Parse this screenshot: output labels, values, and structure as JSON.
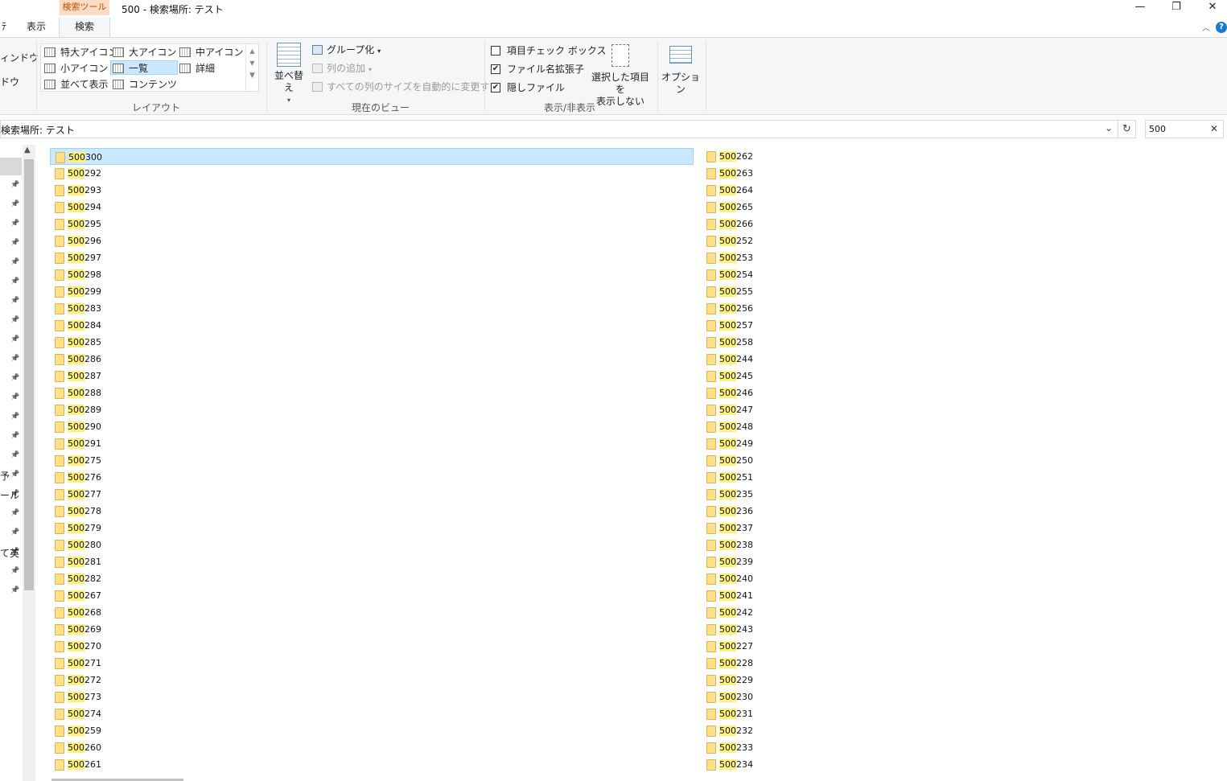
{
  "window": {
    "title": "500 - 検索場所: テスト",
    "tool_tab": "検索ツール",
    "minimize": "—",
    "restore": "❐",
    "close": "✕"
  },
  "tabs": [
    {
      "label": "ﾃ"
    },
    {
      "label": "表示"
    },
    {
      "label": "検索"
    }
  ],
  "ribbon": {
    "pane_frag1": "ィンドウ",
    "pane_frag2": "ドウ",
    "layout": {
      "items": [
        "特大アイコン",
        "大アイコン",
        "中アイコン",
        "小アイコン",
        "一覧",
        "詳細",
        "並べて表示",
        "コンテンツ"
      ],
      "selected": "一覧",
      "label": "レイアウト"
    },
    "view": {
      "sort": "並べ替え",
      "group": "グループ化",
      "add_column": "列の追加",
      "autosize": "すべての列のサイズを自動的に変更する",
      "label": "現在のビュー"
    },
    "showhide": {
      "item_checkbox": "項目チェック ボックス",
      "extensions": "ファイル名拡張子",
      "hidden": "隠しファイル",
      "hide_selected_1": "選択した項目を",
      "hide_selected_2": "表示しない",
      "label": "表示/非表示",
      "checks": [
        false,
        true,
        true
      ]
    },
    "options": "オプション"
  },
  "address": {
    "path": "検索場所: テスト",
    "search_value": "500"
  },
  "nav": {
    "frags": [
      "予",
      "ール",
      "て英"
    ]
  },
  "search_term": "500",
  "files_left": [
    "500300",
    "500292",
    "500293",
    "500294",
    "500295",
    "500296",
    "500297",
    "500298",
    "500299",
    "500283",
    "500284",
    "500285",
    "500286",
    "500287",
    "500288",
    "500289",
    "500290",
    "500291",
    "500275",
    "500276",
    "500277",
    "500278",
    "500279",
    "500280",
    "500281",
    "500282",
    "500267",
    "500268",
    "500269",
    "500270",
    "500271",
    "500272",
    "500273",
    "500274",
    "500259",
    "500260",
    "500261"
  ],
  "files_right": [
    "500262",
    "500263",
    "500264",
    "500265",
    "500266",
    "500252",
    "500253",
    "500254",
    "500255",
    "500256",
    "500257",
    "500258",
    "500244",
    "500245",
    "500246",
    "500247",
    "500248",
    "500249",
    "500250",
    "500251",
    "500235",
    "500236",
    "500237",
    "500238",
    "500239",
    "500240",
    "500241",
    "500242",
    "500243",
    "500227",
    "500228",
    "500229",
    "500230",
    "500231",
    "500232",
    "500233",
    "500234"
  ]
}
